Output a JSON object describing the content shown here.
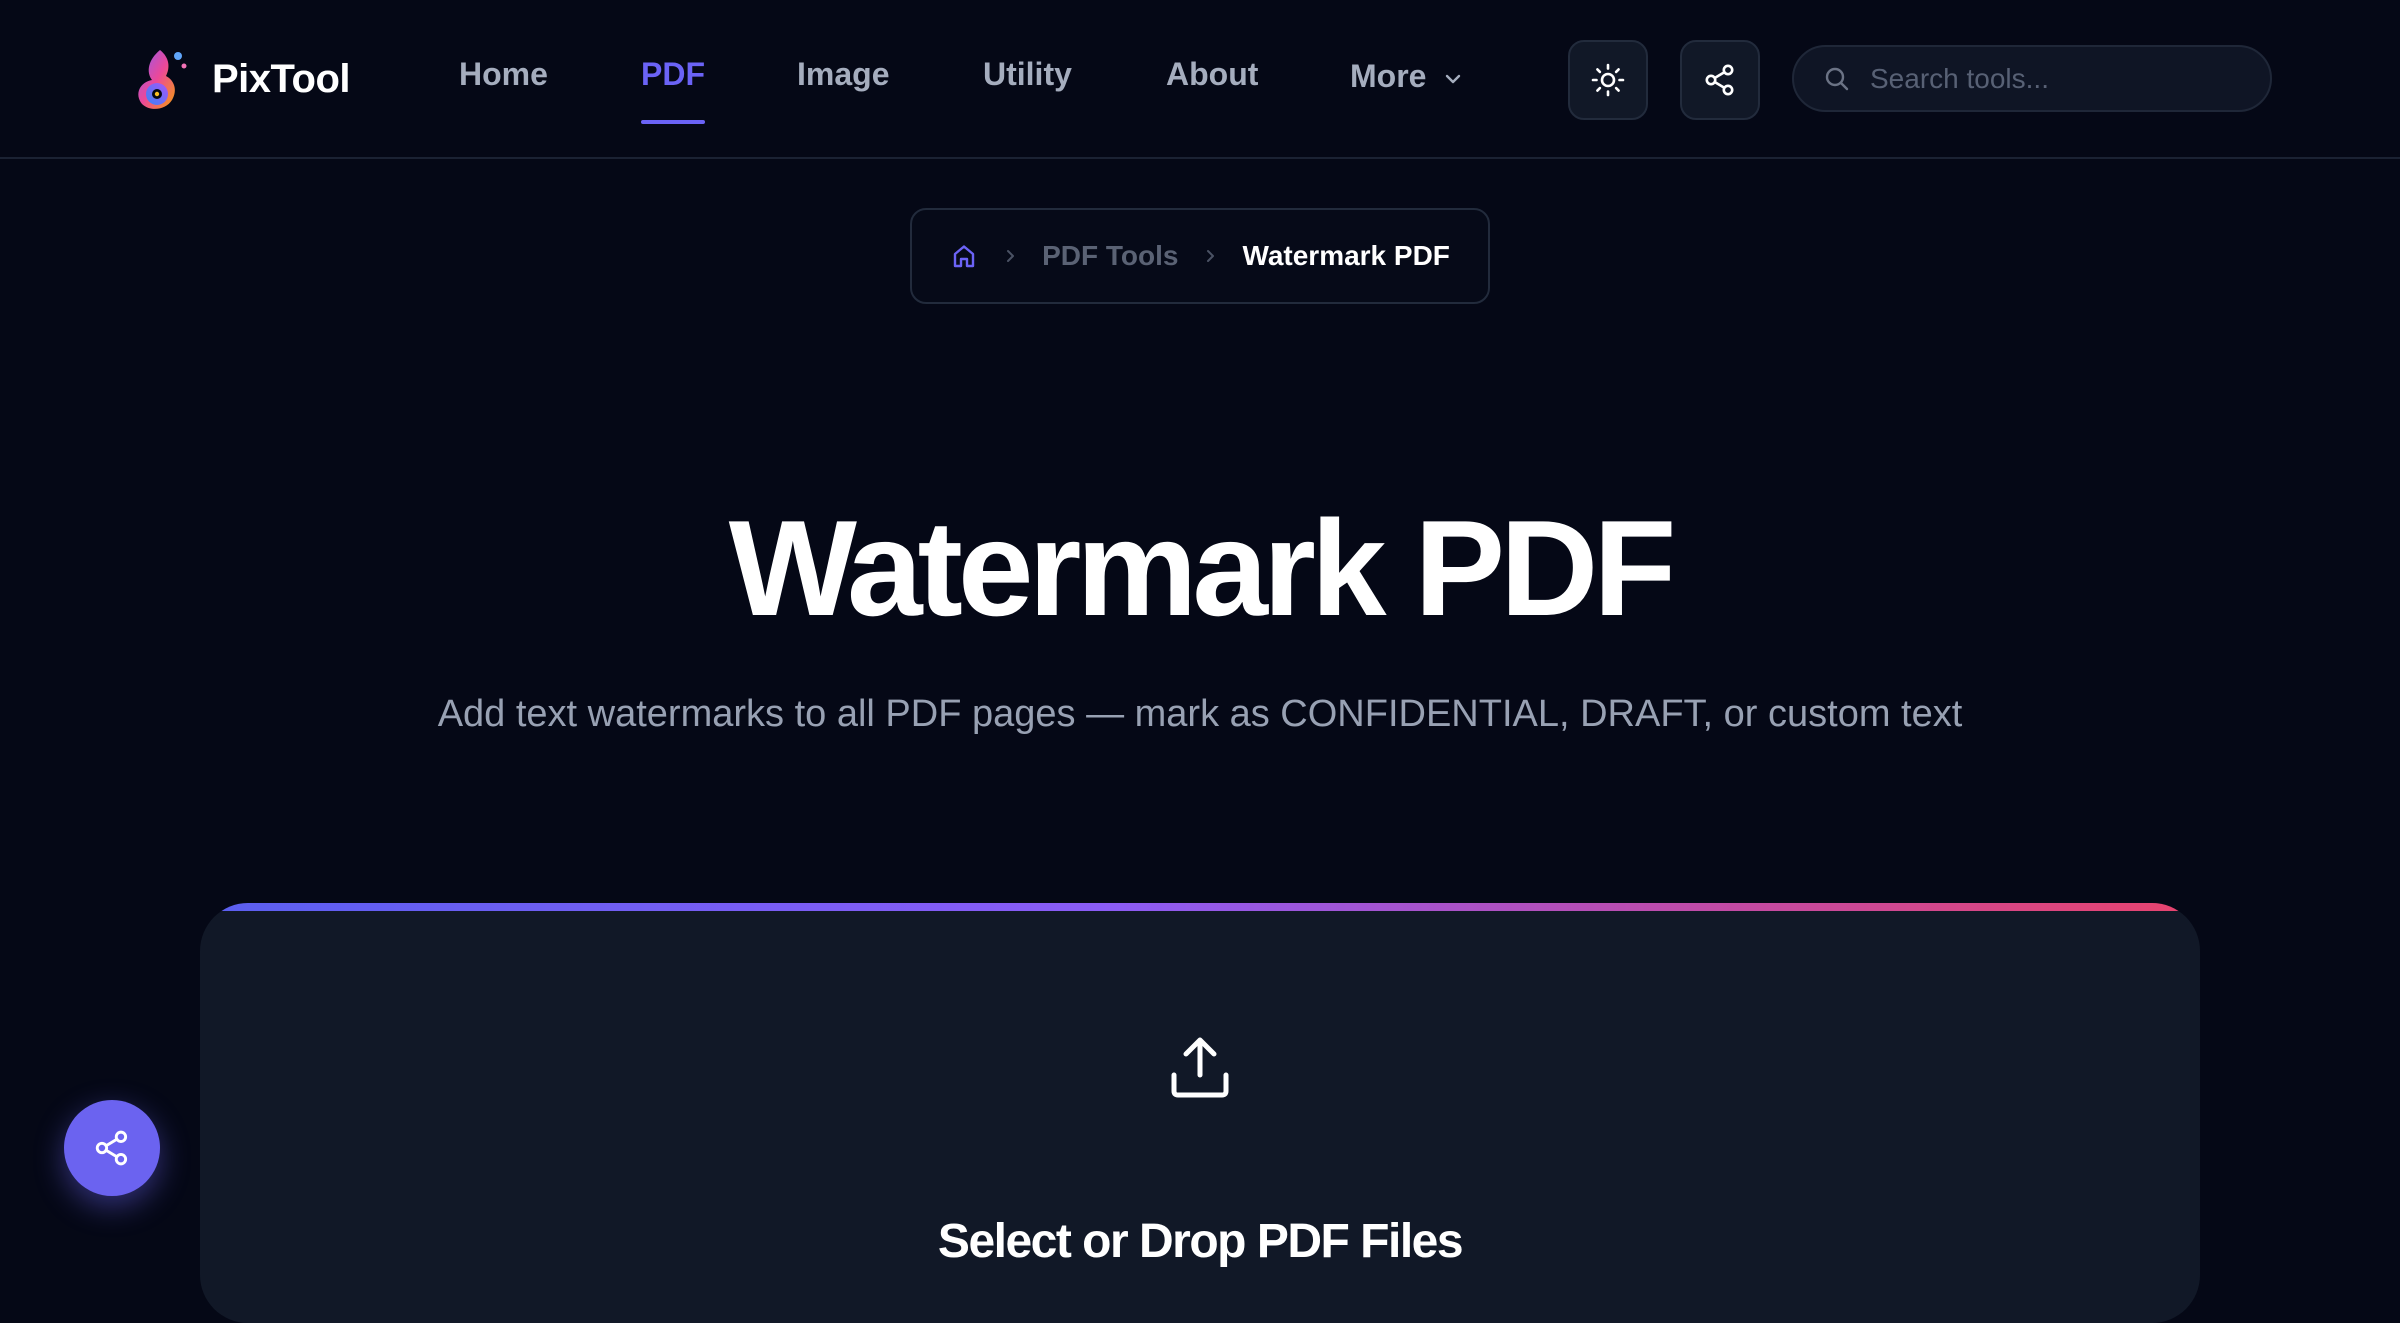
{
  "brand": {
    "name": "PixTool"
  },
  "nav": {
    "items": [
      {
        "label": "Home"
      },
      {
        "label": "PDF",
        "active": true
      },
      {
        "label": "Image"
      },
      {
        "label": "Utility"
      },
      {
        "label": "About"
      },
      {
        "label": "More",
        "has_dropdown": true
      }
    ]
  },
  "header": {
    "theme_toggle_icon": "sun-icon",
    "share_icon": "share-icon",
    "search": {
      "placeholder": "Search tools...",
      "value": "",
      "icon": "search-icon"
    }
  },
  "breadcrumb": {
    "home_icon": "home-icon",
    "items": [
      "PDF Tools",
      "Watermark PDF"
    ]
  },
  "hero": {
    "title": "Watermark PDF",
    "subtitle": "Add text watermarks to all PDF pages — mark as CONFIDENTIAL, DRAFT, or custom text"
  },
  "upload": {
    "icon": "upload-icon",
    "title": "Select or Drop PDF Files"
  },
  "fab": {
    "icon": "share-icon"
  },
  "colors": {
    "background": "#050816",
    "accent": "#6b63f6",
    "card": "#111827",
    "gradient": [
      "#5b5ff0",
      "#8b5cf6",
      "#c04ba8",
      "#e8436d"
    ]
  }
}
